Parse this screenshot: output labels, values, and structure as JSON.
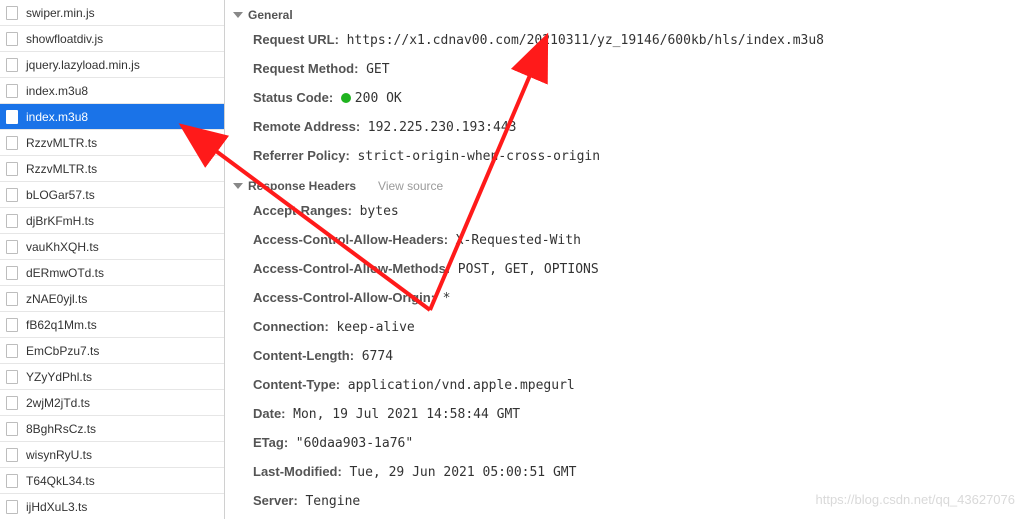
{
  "sidebar": {
    "files": [
      {
        "name": "swiper.min.js",
        "selected": false
      },
      {
        "name": "showfloatdiv.js",
        "selected": false
      },
      {
        "name": "jquery.lazyload.min.js",
        "selected": false
      },
      {
        "name": "index.m3u8",
        "selected": false
      },
      {
        "name": "index.m3u8",
        "selected": true
      },
      {
        "name": "RzzvMLTR.ts",
        "selected": false
      },
      {
        "name": "RzzvMLTR.ts",
        "selected": false
      },
      {
        "name": "bLOGar57.ts",
        "selected": false
      },
      {
        "name": "djBrKFmH.ts",
        "selected": false
      },
      {
        "name": "vauKhXQH.ts",
        "selected": false
      },
      {
        "name": "dERmwOTd.ts",
        "selected": false
      },
      {
        "name": "zNAE0yjl.ts",
        "selected": false
      },
      {
        "name": "fB62q1Mm.ts",
        "selected": false
      },
      {
        "name": "EmCbPzu7.ts",
        "selected": false
      },
      {
        "name": "YZyYdPhl.ts",
        "selected": false
      },
      {
        "name": "2wjM2jTd.ts",
        "selected": false
      },
      {
        "name": "8BghRsCz.ts",
        "selected": false
      },
      {
        "name": "wisynRyU.ts",
        "selected": false
      },
      {
        "name": "T64QkL34.ts",
        "selected": false
      },
      {
        "name": "ijHdXuL3.ts",
        "selected": false
      }
    ]
  },
  "sections": {
    "general_label": "General",
    "response_headers_label": "Response Headers",
    "view_source_label": "View source"
  },
  "general": {
    "request_url_label": "Request URL:",
    "request_url_value": "https://x1.cdnav00.com/20210311/yz_19146/600kb/hls/index.m3u8",
    "request_method_label": "Request Method:",
    "request_method_value": "GET",
    "status_code_label": "Status Code:",
    "status_code_value": "200 OK",
    "remote_address_label": "Remote Address:",
    "remote_address_value": "192.225.230.193:443",
    "referrer_policy_label": "Referrer Policy:",
    "referrer_policy_value": "strict-origin-when-cross-origin"
  },
  "response_headers": {
    "accept_ranges_label": "Accept-Ranges:",
    "accept_ranges_value": "bytes",
    "ac_allow_headers_label": "Access-Control-Allow-Headers:",
    "ac_allow_headers_value": "X-Requested-With",
    "ac_allow_methods_label": "Access-Control-Allow-Methods:",
    "ac_allow_methods_value": "POST, GET, OPTIONS",
    "ac_allow_origin_label": "Access-Control-Allow-Origin:",
    "ac_allow_origin_value": "*",
    "connection_label": "Connection:",
    "connection_value": "keep-alive",
    "content_length_label": "Content-Length:",
    "content_length_value": "6774",
    "content_type_label": "Content-Type:",
    "content_type_value": "application/vnd.apple.mpegurl",
    "date_label": "Date:",
    "date_value": "Mon, 19 Jul 2021 14:58:44 GMT",
    "etag_label": "ETag:",
    "etag_value": "\"60daa903-1a76\"",
    "last_modified_label": "Last-Modified:",
    "last_modified_value": "Tue, 29 Jun 2021 05:00:51 GMT",
    "server_label": "Server:",
    "server_value": "Tengine"
  },
  "watermark": "https://blog.csdn.net/qq_43627076"
}
